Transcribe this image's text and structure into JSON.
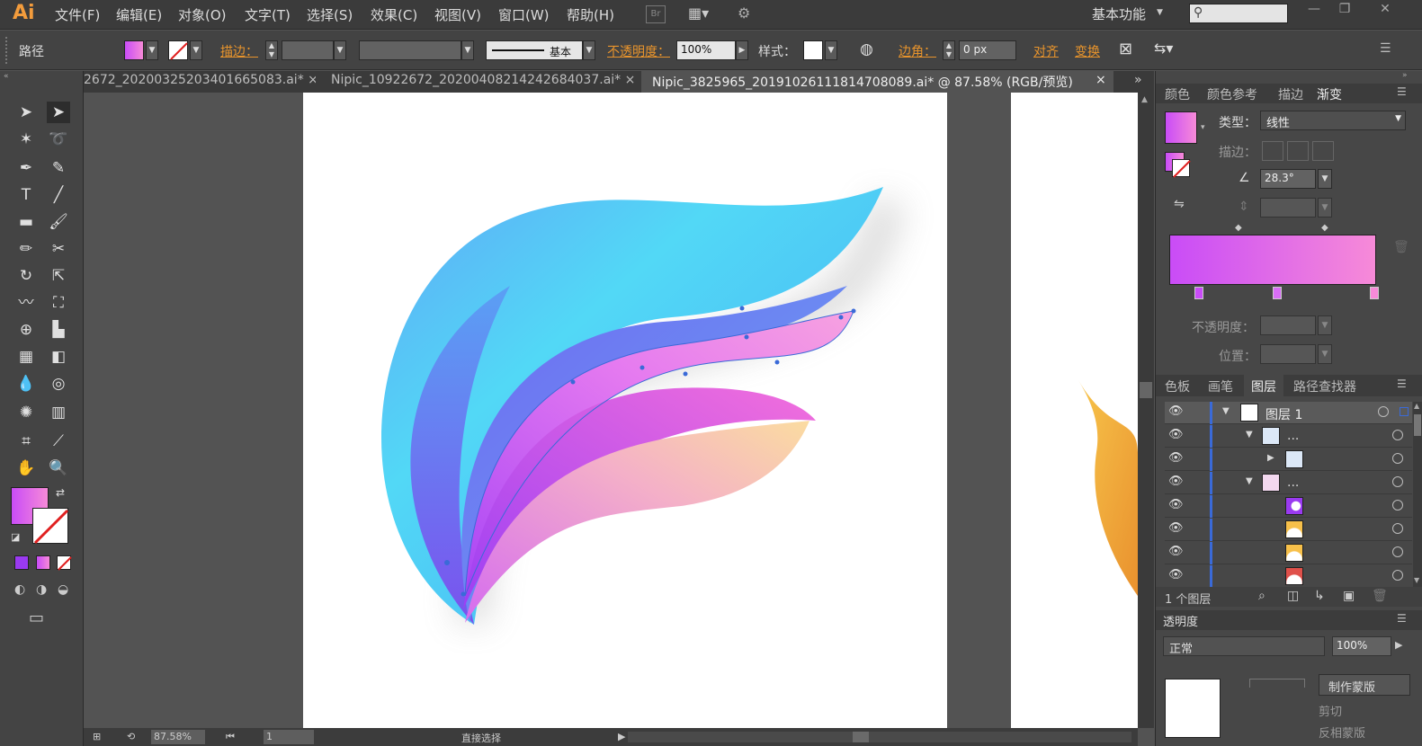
{
  "app": {
    "logo": "Ai",
    "workspace": "基本功能"
  },
  "menu": [
    "文件(F)",
    "编辑(E)",
    "对象(O)",
    "文字(T)",
    "选择(S)",
    "效果(C)",
    "视图(V)",
    "窗口(W)",
    "帮助(H)"
  ],
  "menu_extra": {
    "br_icon": "Br"
  },
  "control": {
    "object_type": "路径",
    "stroke_label": "描边：",
    "stroke_style": "基本",
    "opacity_label": "不透明度：",
    "opacity_value": "100%",
    "style_label": "样式：",
    "corner_label": "边角：",
    "corner_value": "0 px",
    "align_label": "对齐",
    "transform_label": "变换"
  },
  "tabs": [
    {
      "label": "2672_20200325203401665083.ai*",
      "active": false
    },
    {
      "label": "Nipic_10922672_20200408214242684037.ai*",
      "active": false
    },
    {
      "label": "Nipic_3825965_20191026111814708089.ai* @ 87.58% (RGB/预览)",
      "active": true
    }
  ],
  "gradient_panel": {
    "tabs": [
      "颜色",
      "颜色参考",
      "描边",
      "渐变"
    ],
    "active_tab": "渐变",
    "type_label": "类型：",
    "type_value": "线性",
    "stroke_label": "描边：",
    "angle_value": "28.3°",
    "opacity_label": "不透明度：",
    "position_label": "位置：",
    "colors": {
      "start": "#c94cf7",
      "end": "#f78ad8"
    }
  },
  "layers_panel": {
    "tabs": [
      "色板",
      "画笔",
      "图层",
      "路径查找器"
    ],
    "active_tab": "图层",
    "rows": [
      {
        "name": "图层 1",
        "indent": 0,
        "expanded": true
      },
      {
        "name": "...",
        "indent": 1,
        "expanded": true
      },
      {
        "name": "",
        "indent": 2,
        "expanded": false
      },
      {
        "name": "...",
        "indent": 1,
        "expanded": true
      },
      {
        "name": "",
        "indent": 2
      },
      {
        "name": "",
        "indent": 2
      },
      {
        "name": "",
        "indent": 2
      },
      {
        "name": "",
        "indent": 2
      }
    ],
    "footer": "1 个图层"
  },
  "transparency_panel": {
    "title": "透明度",
    "mode": "正常",
    "opacity": "100%",
    "make_mask": "制作蒙版",
    "clip": "剪切",
    "invert": "反相蒙版"
  },
  "bottom": {
    "zoom": "87.58%",
    "page": "1",
    "tool_status": "直接选择"
  },
  "colors": {
    "accent": "#e8942c",
    "selection": "#3a6ad8"
  }
}
